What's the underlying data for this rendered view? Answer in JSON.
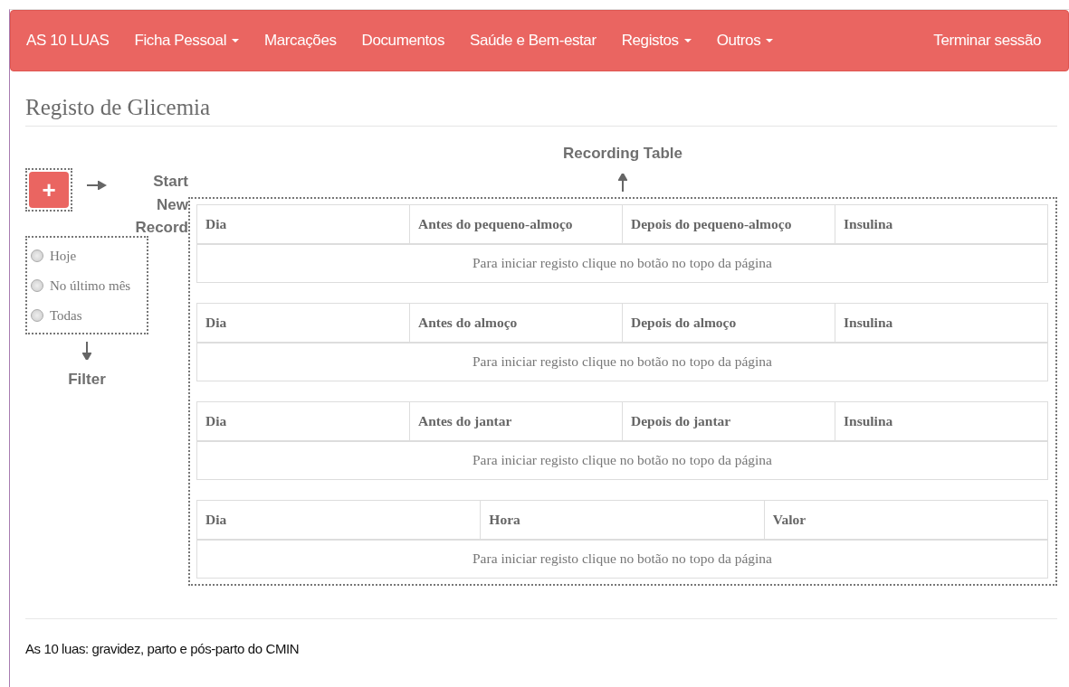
{
  "navbar": {
    "brand": "AS 10 LUAS",
    "items": [
      {
        "label": "Ficha Pessoal",
        "dropdown": true
      },
      {
        "label": "Marcações",
        "dropdown": false
      },
      {
        "label": "Documentos",
        "dropdown": false
      },
      {
        "label": "Saúde e Bem-estar",
        "dropdown": false
      },
      {
        "label": "Registos",
        "dropdown": true
      },
      {
        "label": "Outros",
        "dropdown": true
      }
    ],
    "logout": "Terminar sessão"
  },
  "page_title": "Registo de Glicemia",
  "new_record_button": {
    "label": "+"
  },
  "filters": [
    {
      "label": "Hoje",
      "selected": false
    },
    {
      "label": "No último mês",
      "selected": false
    },
    {
      "label": "Todas",
      "selected": false
    }
  ],
  "annotations": {
    "new_record": "Start New Record",
    "table": "Recording Table",
    "filter": "Filter"
  },
  "tables": [
    {
      "columns": [
        "Dia",
        "Antes do pequeno-almoço",
        "Depois do pequeno-almoço",
        "Insulina"
      ],
      "empty_message": "Para iniciar registo clique no botão no topo da página"
    },
    {
      "columns": [
        "Dia",
        "Antes do almoço",
        "Depois do almoço",
        "Insulina"
      ],
      "empty_message": "Para iniciar registo clique no botão no topo da página"
    },
    {
      "columns": [
        "Dia",
        "Antes do jantar",
        "Depois do jantar",
        "Insulina"
      ],
      "empty_message": "Para iniciar registo clique no botão no topo da página"
    },
    {
      "columns": [
        "Dia",
        "Hora",
        "Valor"
      ],
      "empty_message": "Para iniciar registo clique no botão no topo da página"
    }
  ],
  "footer": "As 10 luas: gravidez, parto e pós-parto do CMIN"
}
